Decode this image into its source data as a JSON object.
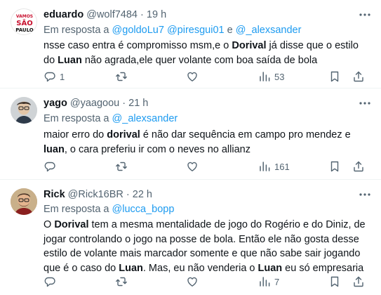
{
  "tweets": [
    {
      "name": "eduardo",
      "handle": "@wolf7484",
      "time": "19 h",
      "reply_prefix": "Em resposta a",
      "mentions": [
        "@goldoLu7",
        "@piresgui01",
        "@_alexsander"
      ],
      "reply_sep_1": " ",
      "reply_sep_2": " e ",
      "body_parts": [
        "nsse caso entra é compromisso msm,e o ",
        "Dorival",
        " já disse que o estilo do ",
        "Luan",
        " não agrada,ele quer volante com boa saída de bola"
      ],
      "replies": "1",
      "retweets": "",
      "likes": "",
      "views": "53",
      "avatar_text": [
        "VAMOS",
        "SÃO",
        "PAULO"
      ]
    },
    {
      "name": "yago",
      "handle": "@yaagoou",
      "time": "21 h",
      "reply_prefix": "Em resposta a",
      "mentions": [
        "@_alexsander"
      ],
      "body_parts": [
        "maior erro do ",
        "dorival",
        " é não dar sequência em campo pro mendez e ",
        "luan",
        ", o cara preferiu ir com o neves no allianz"
      ],
      "replies": "",
      "retweets": "",
      "likes": "",
      "views": "161"
    },
    {
      "name": "Rick",
      "handle": "@Rick16BR",
      "time": "22 h",
      "reply_prefix": "Em resposta a",
      "mentions": [
        "@lucca_bopp"
      ],
      "body_parts": [
        "O ",
        "Dorival",
        " tem a mesma mentalidade de jogo do Rogério e do Diniz, de jogar controlando o jogo na posse de bola. Então ele não gosta desse estilo de volante mais marcador somente e que não sabe sair jogando que é o caso do ",
        "Luan",
        ". Mas, eu não venderia o ",
        "Luan",
        " eu só empresaria"
      ],
      "replies": "",
      "retweets": "",
      "likes": "",
      "views": "7"
    }
  ],
  "ui": {
    "dot": "·",
    "more_icon": "more-icon",
    "colors": {
      "link": "#1d9bf0",
      "secondary": "#536471",
      "text": "#0f1419",
      "divider": "#eff3f4"
    }
  }
}
